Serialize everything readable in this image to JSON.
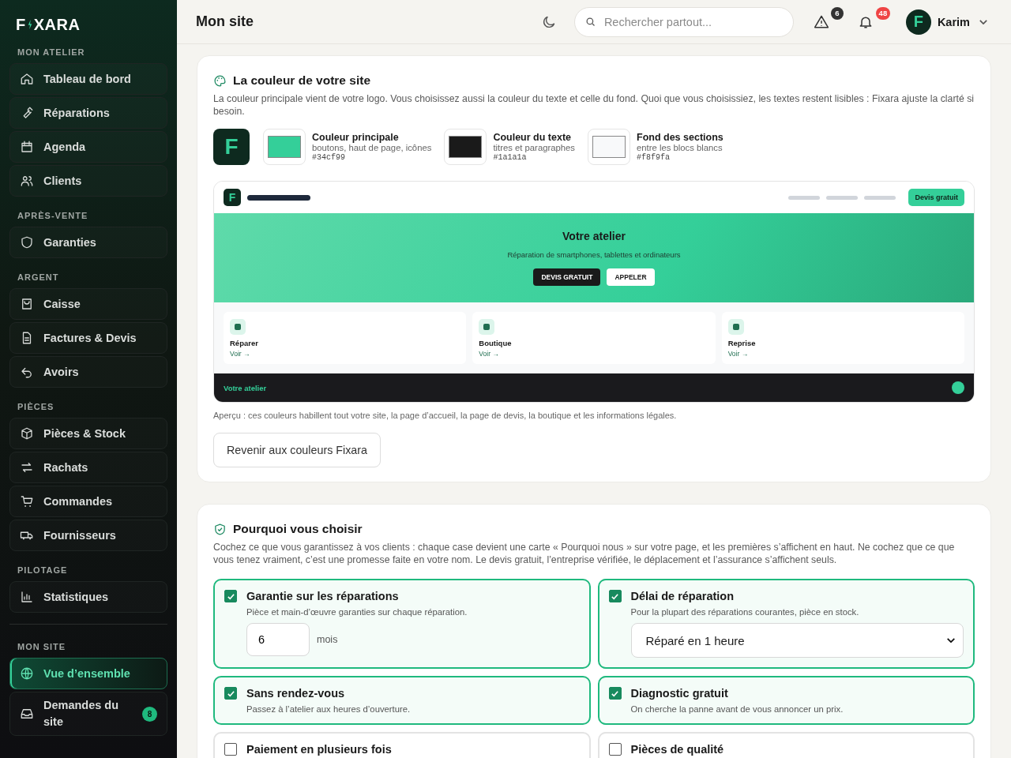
{
  "sidebar": {
    "logo": {
      "left": "F",
      "right": "XARA"
    },
    "sections": [
      {
        "title": "MON ATELIER",
        "separated": false,
        "items": [
          {
            "label": "Tableau de bord",
            "selected": false
          },
          {
            "label": "Réparations",
            "selected": false
          },
          {
            "label": "Agenda",
            "selected": false
          },
          {
            "label": "Clients",
            "selected": false
          }
        ]
      },
      {
        "title": "APRÈS-VENTE",
        "separated": false,
        "items": [
          {
            "label": "Garanties",
            "selected": false
          }
        ]
      },
      {
        "title": "ARGENT",
        "separated": false,
        "items": [
          {
            "label": "Caisse",
            "selected": false
          },
          {
            "label": "Factures & Devis",
            "selected": false
          },
          {
            "label": "Avoirs",
            "selected": false
          }
        ]
      },
      {
        "title": "PIÈCES",
        "separated": false,
        "items": [
          {
            "label": "Pièces & Stock",
            "selected": false
          },
          {
            "label": "Rachats",
            "selected": false
          },
          {
            "label": "Commandes",
            "selected": false
          },
          {
            "label": "Fournisseurs",
            "selected": false
          }
        ]
      },
      {
        "title": "PILOTAGE",
        "separated": false,
        "items": [
          {
            "label": "Statistiques",
            "selected": false
          }
        ]
      },
      {
        "title": "MON SITE",
        "separated": true,
        "items": [
          {
            "label": "Vue d’ensemble",
            "selected": true
          },
          {
            "label": "Demandes du site",
            "selected": false,
            "badge": "8"
          }
        ]
      }
    ]
  },
  "header": {
    "title": "Mon site",
    "search": {
      "placeholder": "Rechercher partout..."
    },
    "alerts_badge": "6",
    "notifications_badge": "48",
    "user": {
      "initial": "F",
      "name": "Karim"
    }
  },
  "colors_card": {
    "title": "La couleur de votre site",
    "description": "La couleur principale vient de votre logo. Vous choisissez aussi la couleur du texte et celle du fond. Quoi que vous choisissiez, les textes restent lisibles : Fixara ajuste la clarté si besoin.",
    "logo_letter": "F",
    "swatches": [
      {
        "label": "Couleur principale",
        "hint": "boutons, haut de page, icônes",
        "hex": "#34cf99",
        "color": "#34cf99"
      },
      {
        "label": "Couleur du texte",
        "hint": "titres et paragraphes",
        "hex": "#1a1a1a",
        "color": "#1a1a1a"
      },
      {
        "label": "Fond des sections",
        "hint": "entre les blocs blancs",
        "hex": "#f8f9fa",
        "color": "#f8f9fa"
      }
    ],
    "preview": {
      "logo_letter": "F",
      "cta": "Devis gratuit",
      "hero_title": "Votre atelier",
      "hero_subtitle": "Réparation de smartphones, tablettes et ordinateurs",
      "hero_buttons": [
        "DEVIS GRATUIT",
        "APPELER"
      ],
      "cards": [
        {
          "title": "Réparer",
          "link": "Voir →"
        },
        {
          "title": "Boutique",
          "link": "Voir →"
        },
        {
          "title": "Reprise",
          "link": "Voir →"
        }
      ],
      "footer": "Votre atelier"
    },
    "note": "Aperçu : ces couleurs habillent tout votre site, la page d’accueil, la page de devis, la boutique et les informations légales.",
    "reset_button": "Revenir aux couleurs Fixara"
  },
  "reasons_card": {
    "title": "Pourquoi vous choisir",
    "description": "Cochez ce que vous garantissez à vos clients : chaque case devient une carte « Pourquoi nous » sur votre page, et les premières s’affichent en haut. Ne cochez que ce que vous tenez vraiment, c’est une promesse faite en votre nom. Le devis gratuit, l’entreprise vérifiée, le déplacement et l’assurance s’affichent seuls.",
    "options": [
      {
        "title": "Garantie sur les réparations",
        "description": "Pièce et main-d’œuvre garanties sur chaque réparation.",
        "checked": true,
        "control": {
          "kind": "number",
          "value": "6",
          "unit": "mois"
        }
      },
      {
        "title": "Délai de réparation",
        "description": "Pour la plupart des réparations courantes, pièce en stock.",
        "checked": true,
        "control": {
          "kind": "select",
          "value": "Réparé en 1 heure"
        }
      },
      {
        "title": "Sans rendez-vous",
        "description": "Passez à l’atelier aux heures d’ouverture.",
        "checked": true
      },
      {
        "title": "Diagnostic gratuit",
        "description": "On cherche la panne avant de vous annoncer un prix.",
        "checked": true
      },
      {
        "title": "Paiement en plusieurs fois",
        "checked": false
      },
      {
        "title": "Pièces de qualité",
        "checked": false
      }
    ]
  }
}
